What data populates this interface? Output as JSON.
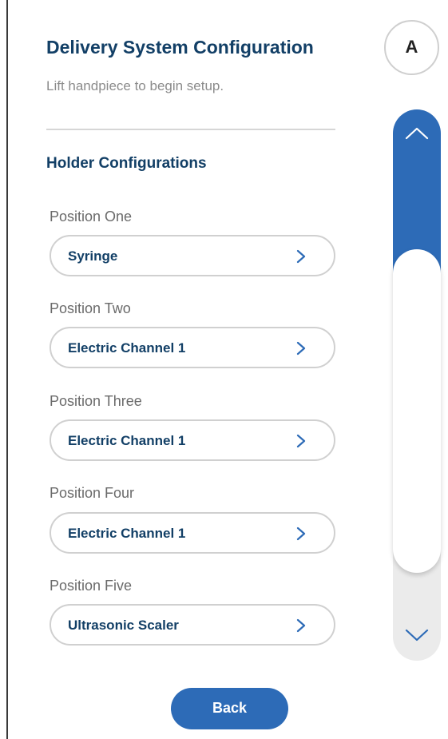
{
  "header": {
    "title": "Delivery System Configuration",
    "subtitle": "Lift handpiece to begin setup."
  },
  "avatar": {
    "initial": "A"
  },
  "section": {
    "title": "Holder Configurations"
  },
  "positions": [
    {
      "label": "Position One",
      "value": "Syringe"
    },
    {
      "label": "Position Two",
      "value": "Electric Channel 1"
    },
    {
      "label": "Position Three",
      "value": "Electric Channel 1"
    },
    {
      "label": "Position Four",
      "value": "Electric Channel 1"
    },
    {
      "label": "Position Five",
      "value": "Ultrasonic Scaler"
    }
  ],
  "footer": {
    "back_label": "Back"
  },
  "colors": {
    "accent": "#2d6bb7",
    "heading": "#123f66",
    "muted_text": "#8b8b8b",
    "border": "#d0d0d0"
  },
  "icons": {
    "select_chevron": "chevron-right-icon",
    "scroll_up": "chevron-up-icon",
    "scroll_down": "chevron-down-icon"
  }
}
